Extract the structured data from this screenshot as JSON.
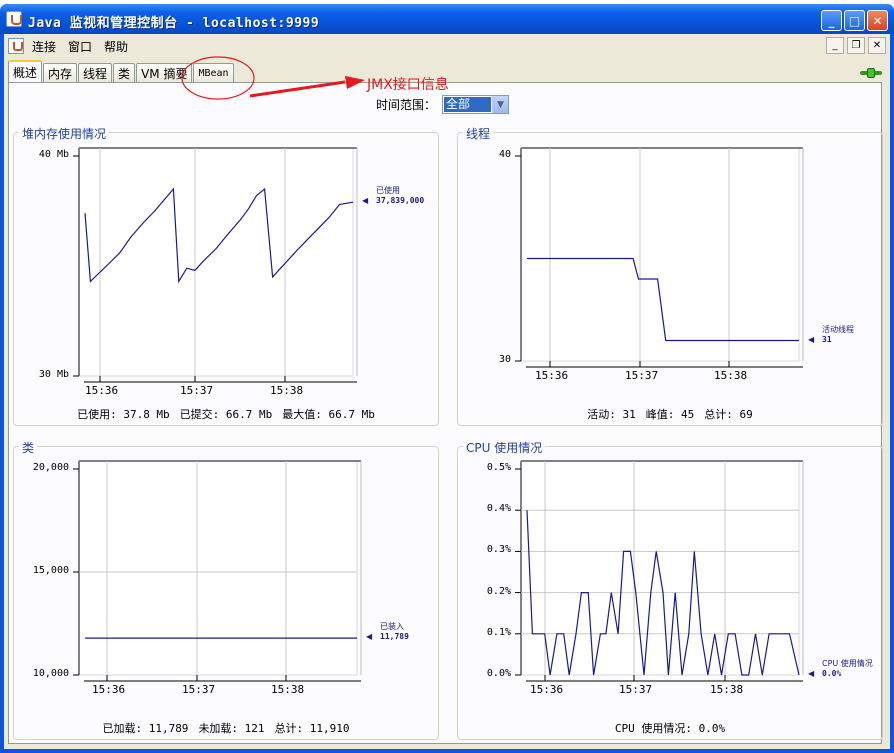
{
  "window": {
    "title": "Java 监视和管理控制台 - localhost:9999",
    "colors": {
      "titlebar": "#0653d6",
      "accent_tab": "#ffc83c",
      "series": "#1a1a8c",
      "annotation": "#e8181c"
    }
  },
  "menu": {
    "items": [
      "连接",
      "窗口",
      "帮助"
    ]
  },
  "tabs": [
    "概述",
    "内存",
    "线程",
    "类",
    "VM 摘要",
    "MBean"
  ],
  "annotation": {
    "text": "JMX接口信息"
  },
  "time_range": {
    "label": "时间范围：",
    "selected": "全部"
  },
  "charts": {
    "heap": {
      "title": "堆内存使用情况",
      "y_ticks": [
        "40 Mb",
        "30 Mb"
      ],
      "x_ticks": [
        "15:36",
        "15:37",
        "15:38"
      ],
      "legend_name": "已使用",
      "legend_value": "37,839,000",
      "summary": [
        "已使用: 37.8 Mb",
        "已提交: 66.7 Mb",
        "最大值: 66.7 Mb"
      ]
    },
    "threads": {
      "title": "线程",
      "y_ticks": [
        "40",
        "30"
      ],
      "x_ticks": [
        "15:36",
        "15:37",
        "15:38"
      ],
      "legend_name": "活动线程",
      "legend_value": "31",
      "summary": [
        "活动: 31",
        "峰值: 45",
        "总计: 69"
      ]
    },
    "classes": {
      "title": "类",
      "y_ticks": [
        "20,000",
        "15,000",
        "10,000"
      ],
      "x_ticks": [
        "15:36",
        "15:37",
        "15:38"
      ],
      "legend_name": "已装入",
      "legend_value": "11,789",
      "summary": [
        "已加载: 11,789",
        "未加载: 121",
        "总计: 11,910"
      ]
    },
    "cpu": {
      "title": "CPU 使用情况",
      "y_ticks": [
        "0.5%",
        "0.4%",
        "0.3%",
        "0.2%",
        "0.1%",
        "0.0%"
      ],
      "x_ticks": [
        "15:36",
        "15:37",
        "15:38"
      ],
      "legend_name": "CPU 使用情况",
      "legend_value": "0.0%",
      "summary": [
        "CPU 使用情况: 0.0%"
      ]
    }
  },
  "chart_data": [
    {
      "type": "line",
      "title": "堆内存使用情况",
      "ylim": [
        30,
        40
      ],
      "x": [
        0.0,
        0.02,
        0.08,
        0.13,
        0.17,
        0.22,
        0.26,
        0.33,
        0.35,
        0.38,
        0.41,
        0.44,
        0.49,
        0.53,
        0.58,
        0.61,
        0.64,
        0.67,
        0.7,
        0.73,
        0.76,
        0.79,
        0.83,
        0.87,
        0.91,
        0.95,
        1.0
      ],
      "series": [
        {
          "name": "已使用",
          "values": [
            37.4,
            34.3,
            35.0,
            35.6,
            36.3,
            37.0,
            37.5,
            38.5,
            34.3,
            34.9,
            34.8,
            35.2,
            35.8,
            36.4,
            37.1,
            37.6,
            38.2,
            38.5,
            34.5,
            34.9,
            35.3,
            35.7,
            36.2,
            36.7,
            37.2,
            37.8,
            37.9
          ]
        }
      ],
      "xlabel": "",
      "ylabel": "",
      "x_ticks": [
        "15:36",
        "15:37",
        "15:38"
      ]
    },
    {
      "type": "line",
      "title": "线程",
      "ylim": [
        30,
        40
      ],
      "x": [
        0.0,
        0.39,
        0.41,
        0.48,
        0.51,
        1.0
      ],
      "series": [
        {
          "name": "活动线程",
          "values": [
            35.0,
            35.0,
            34.0,
            34.0,
            31.0,
            31.0
          ]
        }
      ],
      "xlabel": "",
      "ylabel": "",
      "x_ticks": [
        "15:36",
        "15:37",
        "15:38"
      ]
    },
    {
      "type": "line",
      "title": "类",
      "ylim": [
        10000,
        20000
      ],
      "x": [
        0.0,
        1.0
      ],
      "series": [
        {
          "name": "已装入",
          "values": [
            11789,
            11789
          ]
        }
      ],
      "xlabel": "",
      "ylabel": "",
      "x_ticks": [
        "15:36",
        "15:37",
        "15:38"
      ]
    },
    {
      "type": "line",
      "title": "CPU 使用情况",
      "ylim": [
        0,
        0.5
      ],
      "x": [
        0.0,
        0.02,
        0.04,
        0.065,
        0.085,
        0.11,
        0.135,
        0.155,
        0.18,
        0.2,
        0.225,
        0.245,
        0.27,
        0.29,
        0.31,
        0.335,
        0.355,
        0.38,
        0.4,
        0.43,
        0.455,
        0.475,
        0.5,
        0.52,
        0.545,
        0.57,
        0.595,
        0.615,
        0.64,
        0.665,
        0.69,
        0.715,
        0.74,
        0.765,
        0.79,
        0.815,
        0.84,
        0.865,
        0.89,
        0.915,
        0.94,
        0.965,
        1.0
      ],
      "series": [
        {
          "name": "CPU 使用情况",
          "values": [
            0.4,
            0.1,
            0.1,
            0.1,
            0.0,
            0.1,
            0.1,
            0.0,
            0.1,
            0.2,
            0.2,
            0.0,
            0.1,
            0.1,
            0.2,
            0.1,
            0.3,
            0.3,
            0.2,
            0.0,
            0.2,
            0.3,
            0.2,
            0.0,
            0.2,
            0.0,
            0.1,
            0.3,
            0.1,
            0.0,
            0.1,
            0.0,
            0.1,
            0.1,
            0.0,
            0.0,
            0.1,
            0.0,
            0.1,
            0.1,
            0.1,
            0.1,
            0.0
          ]
        }
      ],
      "xlabel": "",
      "ylabel": "",
      "x_ticks": [
        "15:36",
        "15:37",
        "15:38"
      ]
    }
  ]
}
